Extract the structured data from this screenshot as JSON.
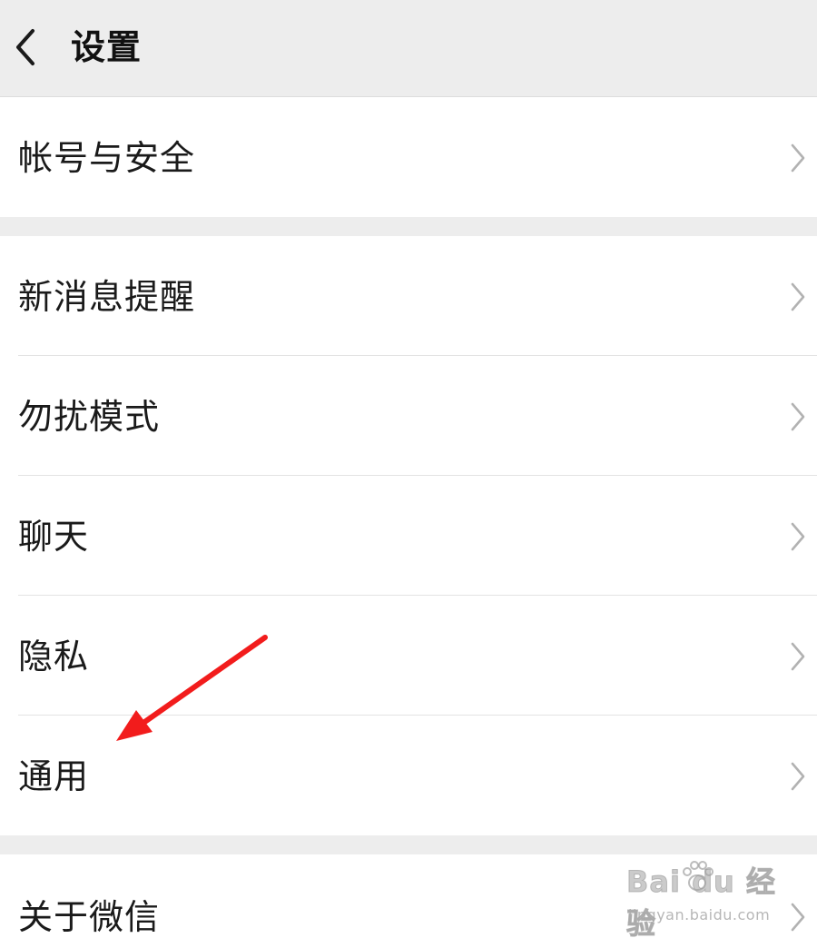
{
  "header": {
    "title": "设置",
    "back_icon": "chevron-left-icon"
  },
  "groups": [
    {
      "items": [
        {
          "label": "帐号与安全",
          "icon": "chevron-right-icon"
        }
      ]
    },
    {
      "items": [
        {
          "label": "新消息提醒",
          "icon": "chevron-right-icon"
        },
        {
          "label": "勿扰模式",
          "icon": "chevron-right-icon"
        },
        {
          "label": "聊天",
          "icon": "chevron-right-icon"
        },
        {
          "label": "隐私",
          "icon": "chevron-right-icon"
        },
        {
          "label": "通用",
          "icon": "chevron-right-icon"
        }
      ]
    },
    {
      "items": [
        {
          "label": "关于微信",
          "icon": "chevron-right-icon"
        }
      ]
    }
  ],
  "annotation": {
    "type": "red-arrow",
    "color": "#f21c1c",
    "points_to": "通用"
  },
  "watermark": {
    "logo_text": "Bai du 经验",
    "url": "jingyan.baidu.com"
  },
  "colors": {
    "background": "#ededed",
    "row_background": "#ffffff",
    "text": "#1a1a1a",
    "chevron": "#b2b2b2",
    "divider": "#e3e3e3"
  }
}
